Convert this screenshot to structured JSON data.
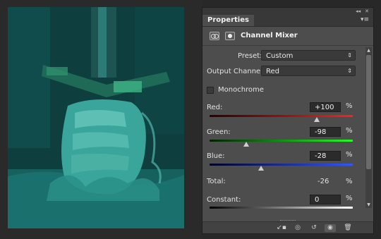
{
  "panel": {
    "tab_label": "Properties",
    "menu_icon": "panel-menu-icon",
    "collapse_icon": "collapse-arrows-icon",
    "close_icon": "close-icon",
    "title": "Channel Mixer"
  },
  "preset": {
    "label": "Preset:",
    "value": "Custom"
  },
  "output_channel": {
    "label": "Output Channel:",
    "value": "Red"
  },
  "monochrome": {
    "label": "Monochrome",
    "checked": false
  },
  "channels": [
    {
      "label": "Red:",
      "value": "+100",
      "unit": "%",
      "slider_fraction": 0.75,
      "color": "#c0392b"
    },
    {
      "label": "Green:",
      "value": "-98",
      "unit": "%",
      "slider_fraction": 0.255,
      "color": "#3fa33f"
    },
    {
      "label": "Blue:",
      "value": "-28",
      "unit": "%",
      "slider_fraction": 0.36,
      "color": "#3b54c8"
    }
  ],
  "total": {
    "label": "Total:",
    "value": "-26",
    "unit": "%"
  },
  "constant": {
    "label": "Constant:",
    "value": "0",
    "unit": "%"
  },
  "toolbar_icons": [
    "clip-to-layer-icon",
    "view-previous-state-icon",
    "reset-icon",
    "visibility-icon",
    "trash-icon"
  ],
  "colors": {
    "panel_bg": "#4d4d4d",
    "photo_tint": "#1aa6a0"
  }
}
